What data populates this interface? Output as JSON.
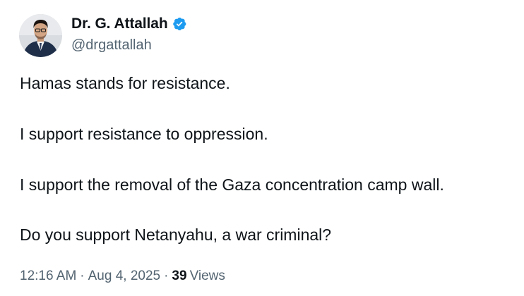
{
  "author": {
    "display_name": "Dr. G. Attallah",
    "handle": "@drgattallah",
    "verified": true,
    "verified_color": "#1d9bf0"
  },
  "tweet": {
    "paragraphs": [
      "Hamas stands for resistance.",
      "I support resistance to oppression.",
      "I support the removal of the Gaza concentration camp wall.",
      "Do you support Netanyahu, a war criminal?"
    ]
  },
  "meta": {
    "time": "12:16 AM",
    "separator": "·",
    "date": "Aug 4, 2025",
    "views_count": "39",
    "views_label": "Views"
  }
}
